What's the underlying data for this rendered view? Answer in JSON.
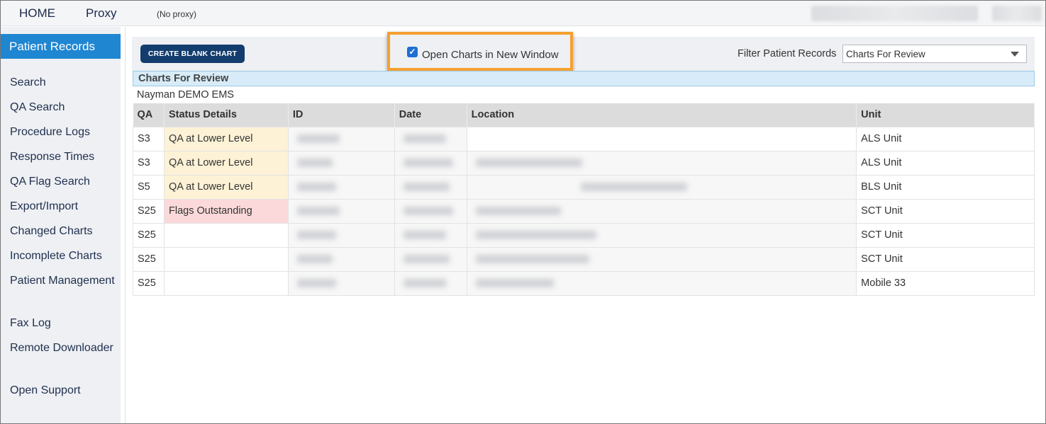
{
  "topnav": {
    "home": "HOME",
    "proxy": "Proxy",
    "proxy_status": "(No proxy)"
  },
  "sidebar": {
    "active": "Patient Records",
    "items": [
      "Search",
      "QA Search",
      "Procedure Logs",
      "Response Times",
      "QA Flag Search",
      "Export/Import",
      "Changed Charts",
      "Incomplete Charts",
      "Patient Management",
      "Fax Log",
      "Remote Downloader",
      "Open Support"
    ]
  },
  "toolbar": {
    "create_label": "CREATE BLANK CHART",
    "open_new_window_label": "Open Charts in New Window",
    "open_new_window_checked": true,
    "filter_label": "Filter Patient Records",
    "filter_value": "Charts For Review"
  },
  "section": {
    "title": "Charts For Review",
    "agency": "Nayman DEMO EMS"
  },
  "table": {
    "headers": [
      "QA",
      "Status Details",
      "ID",
      "Date",
      "Location",
      "Unit"
    ],
    "rows": [
      {
        "qa": "S3",
        "status": "QA at Lower Level",
        "unit": "ALS Unit"
      },
      {
        "qa": "S3",
        "status": "QA at Lower Level",
        "unit": "ALS Unit"
      },
      {
        "qa": "S5",
        "status": "QA at Lower Level",
        "unit": "BLS Unit"
      },
      {
        "qa": "S25",
        "status": "Flags Outstanding",
        "unit": "SCT Unit"
      },
      {
        "qa": "S25",
        "status": "",
        "unit": "SCT Unit"
      },
      {
        "qa": "S25",
        "status": "",
        "unit": "SCT Unit"
      },
      {
        "qa": "S25",
        "status": "",
        "unit": "Mobile 33"
      }
    ]
  },
  "colors": {
    "active_nav": "#1f86d2",
    "button": "#123d6e",
    "highlight": "#f5a031",
    "status_warn": "#fdf2d6",
    "status_flag": "#fbd9da"
  }
}
